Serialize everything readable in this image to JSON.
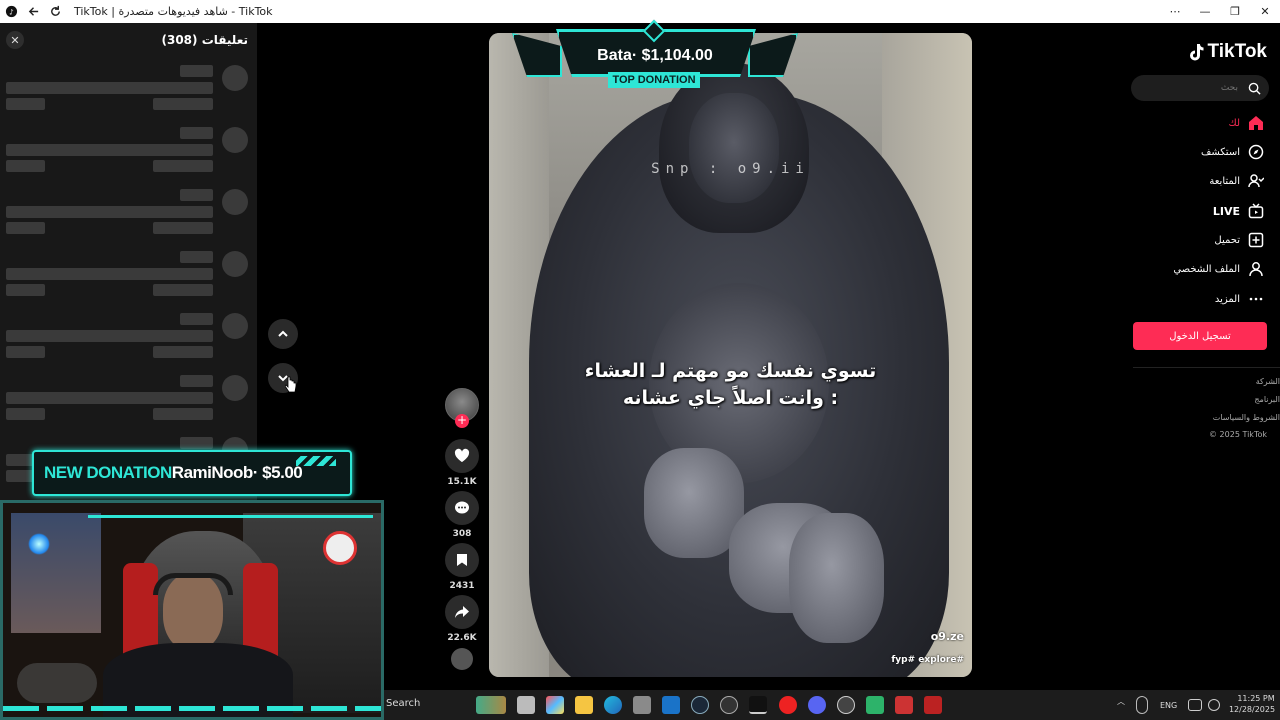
{
  "browser": {
    "title": "TikTok | شاهد فيديوهات متصدرة - TikTok",
    "controls": {
      "menu": "⋯",
      "minimize": "—",
      "restore": "❐",
      "close": "✕"
    }
  },
  "comments": {
    "header": "تعليقات (308)",
    "close_icon": "✕"
  },
  "donation_banner": {
    "prefix": "NEW DONATION",
    "text": "RamiNoob· $5.00"
  },
  "top_donation": {
    "amount": "Bata· $1,104.00",
    "label": "TOP DONATION"
  },
  "video": {
    "watermark": "Snp : o9.ii",
    "caption_line1": "تسوي نفسك مو مهتم لـ العشاء",
    "caption_line2": "وانت اصلاً جاي عشانه :",
    "author_handle": "o9.ze",
    "hashtags": "fyp# explore#"
  },
  "actions": {
    "likes": "15.1K",
    "comments": "308",
    "saves": "2431",
    "shares": "22.6K"
  },
  "sidebar": {
    "logo": "TikTok",
    "search_placeholder": "بحث",
    "menu": [
      {
        "label": "لك",
        "icon": "home-icon",
        "active": true
      },
      {
        "label": "استكشف",
        "icon": "compass-icon"
      },
      {
        "label": "المتابعة",
        "icon": "following-icon"
      },
      {
        "label": "LIVE",
        "icon": "live-icon"
      },
      {
        "label": "تحميل",
        "icon": "upload-icon"
      },
      {
        "label": "الملف الشخصي",
        "icon": "profile-icon"
      },
      {
        "label": "المزيد",
        "icon": "more-icon"
      }
    ],
    "login_button": "تسجيل الدخول",
    "footer": [
      "الشركة",
      "البرنامج",
      "الشروط والسياسات",
      "© 2025 TikTok"
    ]
  },
  "taskbar": {
    "search_label": "Search",
    "lang": "ENG",
    "time": "11:25 PM",
    "date": "12/28/2025"
  },
  "colors": {
    "accent": "#fe2c55",
    "overlay_teal": "#2ee6d6"
  }
}
